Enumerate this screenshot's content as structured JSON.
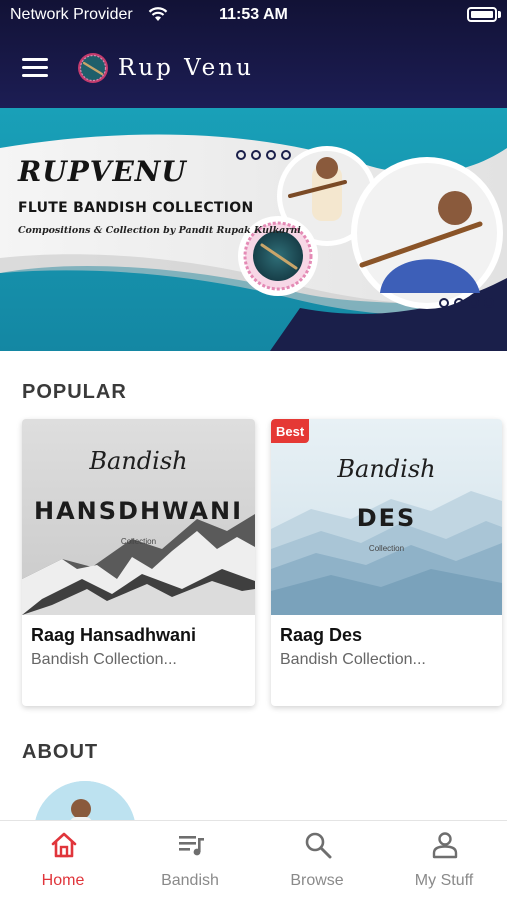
{
  "status_bar": {
    "carrier": "Network Provider",
    "time": "11:53 AM"
  },
  "header": {
    "app_title": "Rup Venu"
  },
  "banner": {
    "title": "RUPVENU",
    "subtitle": "FLUTE BANDISH COLLECTION",
    "credit": "Compositions & Collection by Pandit Rupak Kulkarni"
  },
  "popular": {
    "section_title": "POPULAR",
    "cards": [
      {
        "thumb_script": "Bandish",
        "thumb_title": "HANSDHWANI",
        "thumb_small": "Collection",
        "name": "Raag Hansadhwani",
        "description": "Bandish Collection...",
        "badge": ""
      },
      {
        "thumb_script": "Bandish",
        "thumb_title": "DES",
        "thumb_small": "Collection",
        "name": "Raag Des",
        "description": "Bandish Collection...",
        "badge": "Best"
      }
    ]
  },
  "about": {
    "section_title": "ABOUT"
  },
  "tabs": [
    {
      "label": "Home",
      "icon": "home-icon",
      "active": true
    },
    {
      "label": "Bandish",
      "icon": "playlist-icon",
      "active": false
    },
    {
      "label": "Browse",
      "icon": "search-icon",
      "active": false
    },
    {
      "label": "My Stuff",
      "icon": "person-icon",
      "active": false
    }
  ],
  "colors": {
    "header_bg": "#1c1d54",
    "banner_teal": "#1b9bb5",
    "accent_red": "#e0353b",
    "badge_red": "#e53935"
  }
}
